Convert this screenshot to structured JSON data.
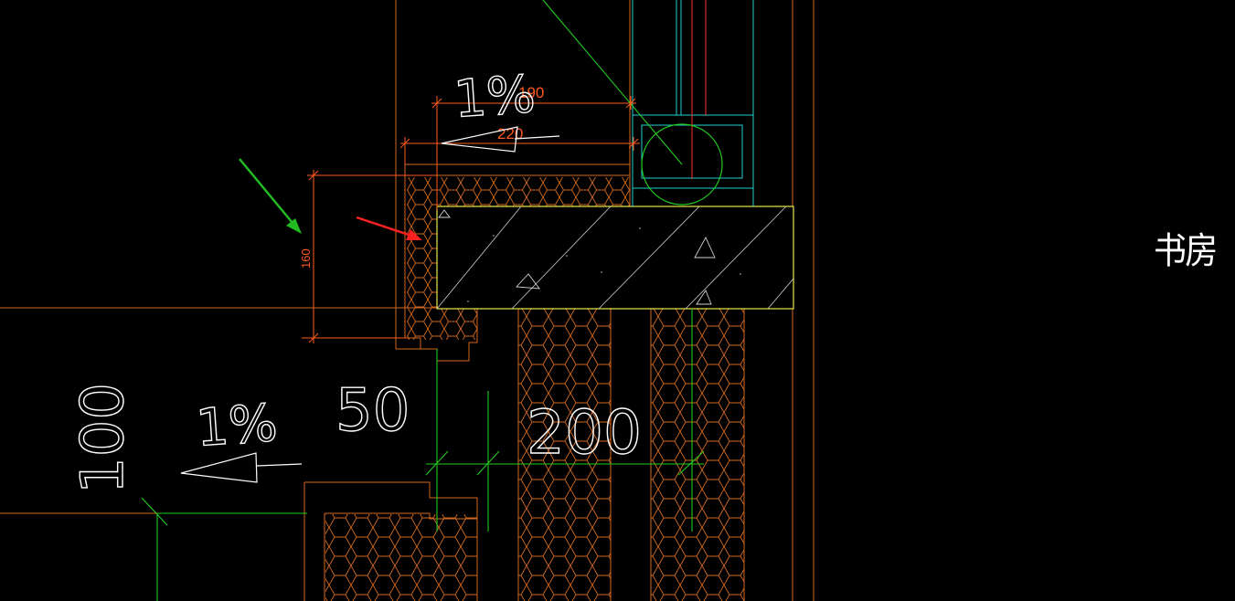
{
  "drawing": {
    "colors": {
      "background": "#000000",
      "wall": "#d2691e",
      "slab": "#e8e84a",
      "dimension": "#ff5a1f",
      "guide": "#22cc22",
      "window": "#22d0d0",
      "text": "#ffffff",
      "arrow_red": "#ff2020",
      "arrow_green": "#22bb22"
    },
    "dimensions": {
      "top_width_190": "190",
      "top_width_220": "220",
      "sill_height_160": "160"
    },
    "annotations": {
      "slope_top": "1%",
      "slope_bottom": "1%",
      "dim_50": "50",
      "dim_200": "200",
      "dim_100": "100"
    },
    "room_label": "书房",
    "icons": [
      "red-pointer-arrow-icon",
      "green-pointer-arrow-icon",
      "slope-arrow-icon",
      "window-pipe-circle-icon"
    ]
  }
}
